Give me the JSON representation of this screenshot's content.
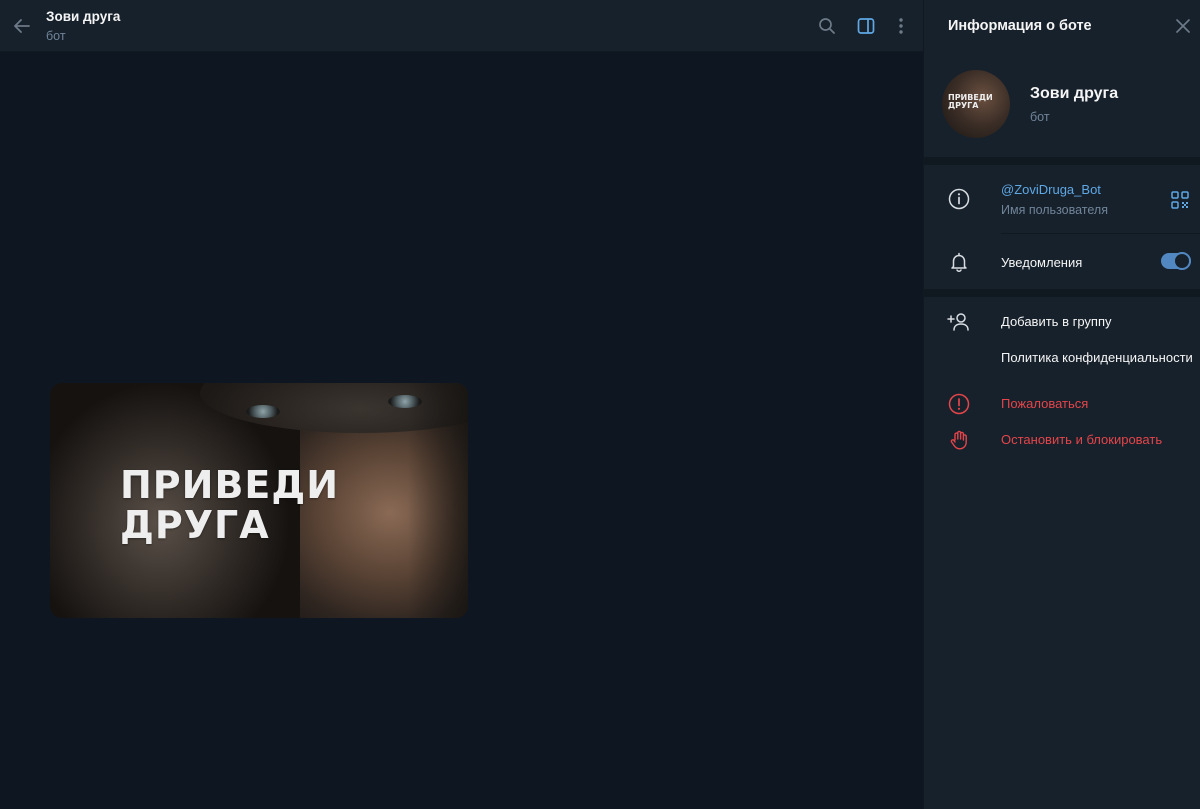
{
  "chat": {
    "title": "Зови друга",
    "subtitle": "бот",
    "media": {
      "headline_line1": "ПРИВЕДИ",
      "headline_line2": "ДРУГА"
    }
  },
  "panel": {
    "title": "Информация о боте",
    "bot_name": "Зови друга",
    "bot_type": "бот",
    "avatar_text_line1": "ПРИВЕДИ",
    "avatar_text_line2": "ДРУГА",
    "username": "@ZoviDruga_Bot",
    "username_label": "Имя пользователя",
    "notifications_label": "Уведомления",
    "notifications_enabled": true,
    "actions": [
      {
        "label": "Добавить в группу",
        "icon": "add-user-icon"
      },
      {
        "label": "Политика конфиденциальности",
        "icon": ""
      },
      {
        "label": "Пожаловаться",
        "icon": "report-icon"
      },
      {
        "label": "Остановить и блокировать",
        "icon": "stop-hand-icon"
      }
    ]
  },
  "colors": {
    "background": "#0e1621",
    "panel": "#17212b",
    "accent": "#5288c1",
    "link": "#5fa8e6",
    "danger": "#e4454a",
    "muted": "#708499"
  }
}
